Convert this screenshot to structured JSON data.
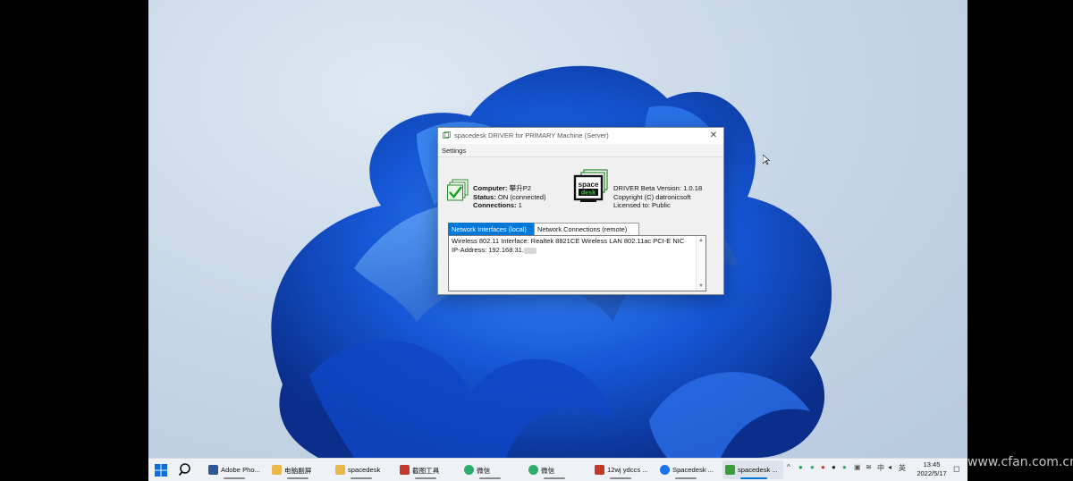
{
  "window": {
    "title": "spacedesk DRIVER for PRIMARY Machine (Server)",
    "close_glyph": "✕",
    "menu_settings": "Settings",
    "computer_label": "Computer:",
    "computer_value": "攀升P2",
    "status_label": "Status:",
    "status_value": "ON (connected)",
    "connections_label": "Connections:",
    "connections_value": "1",
    "driver_version": "DRIVER Beta Version: 1.0.18",
    "copyright": "Copyright (C) datronicsoft",
    "license": "Licensed to:  Public",
    "logo_text_top": "space",
    "logo_text_bottom": "desk",
    "tabs": [
      {
        "label": "Network Interfaces (local)",
        "active": true
      },
      {
        "label": "Network Connections (remote)",
        "active": false
      }
    ],
    "panel_line1": "Wireless 802.11 Interface: Realtek 8821CE Wireless LAN 802.11ac PCI-E NIC",
    "panel_line2": "IP-Address: 192.168.31."
  },
  "taskbar": {
    "buttons": [
      {
        "label": "Adobe Pho...",
        "color": "#2b579a",
        "icon": "photoshop-icon"
      },
      {
        "label": "电脑副屏",
        "color": "#e8b84a",
        "icon": "folder-icon"
      },
      {
        "label": "spacedesk",
        "color": "#e8b84a",
        "icon": "folder-icon"
      },
      {
        "label": "截图工具",
        "color": "#c0392b",
        "icon": "snipping-tool-icon"
      },
      {
        "label": "微信",
        "color": "#2aae67",
        "icon": "wechat-icon"
      },
      {
        "label": "微信",
        "color": "#2aae67",
        "icon": "wechat-icon"
      },
      {
        "label": "12wj ydccs ...",
        "color": "#c0392b",
        "icon": "wps-icon"
      },
      {
        "label": "Spacedesk ...",
        "color": "#1a73e8",
        "icon": "edge-icon"
      },
      {
        "label": "spacedesk ...",
        "color": "#3a9d3a",
        "icon": "spacedesk-icon"
      }
    ],
    "tray_chevron": "^",
    "tray_ime": "中",
    "tray_lang": "英",
    "clock_time": "13:45",
    "clock_date": "2022/5/17"
  },
  "watermark": "www.cfan.com.cn",
  "colors": {
    "accent": "#0078d7",
    "taskbar": "#eef1f6",
    "bloom": "#1e5fd8"
  }
}
